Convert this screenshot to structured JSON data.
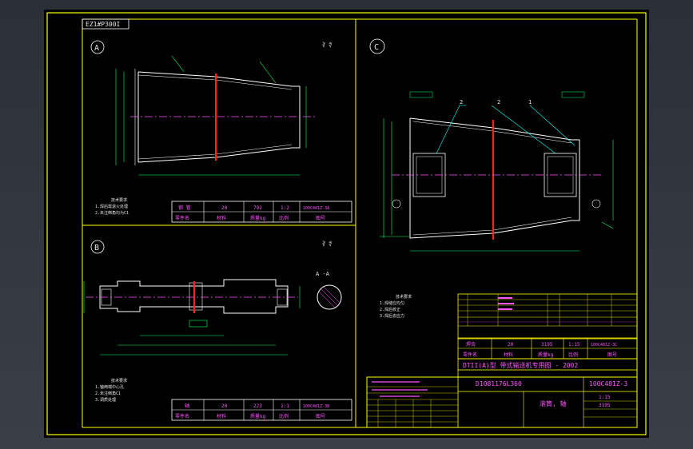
{
  "drawing_code": "EZ1#P300I",
  "views": {
    "a_label": "A",
    "b_label": "B",
    "c_label": "C",
    "section_label": "A -A",
    "roughness_a": "∛ ∜",
    "roughness_b": "∛ ∜"
  },
  "tables": {
    "a": {
      "row1": [
        "钢 管",
        "20",
        "792",
        "1:2",
        "100C481Z-3A"
      ],
      "row2": [
        "零件名",
        "材料",
        "质量kg",
        "比例",
        "图号"
      ]
    },
    "b": {
      "row1": [
        "轴",
        "20",
        "223",
        "1:1",
        "100C481Z-3B"
      ],
      "row2": [
        "零件名",
        "材料",
        "质量kg",
        "比例",
        "图号"
      ]
    },
    "c": {
      "row1": [
        "焊合",
        "20",
        "3195",
        "1:15",
        "100C481Z-3C"
      ],
      "row2": [
        "零件名",
        "材料",
        "质量kg",
        "比例",
        "图号"
      ]
    }
  },
  "notes": {
    "a": [
      "技术要求",
      "1.焊后需退火处理",
      "2.未注倒角均为C1"
    ],
    "b": [
      "技术要求",
      "1.轴两端中心孔",
      "2.未注倒角C1",
      "3.调质处理"
    ],
    "c": [
      "技术要求",
      "1.焊缝应均匀",
      "2.焊后校正",
      "3.焊后去应力"
    ]
  },
  "title_block": {
    "project": "DTII(A)型 带式输送机专用图 - 2002",
    "spec": "D1081176L360",
    "drawing_no": "100C481Z-3",
    "part_name": "滚筒, 轴",
    "scale": "1:15",
    "mass": "3195"
  },
  "colors": {
    "background": "#000000",
    "frame": "#ffff00",
    "outline": "#ffffff",
    "center": "#ff00ff",
    "dim": "#00ff66",
    "weld": "#ff2020",
    "leader": "#00ffff"
  }
}
